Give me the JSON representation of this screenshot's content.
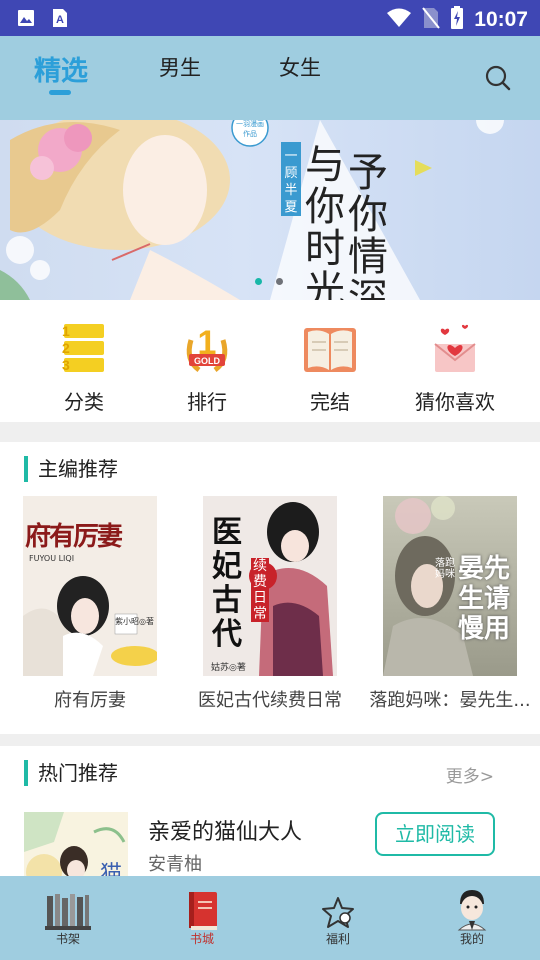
{
  "status_bar": {
    "time": "10:07",
    "icons": [
      "image-icon",
      "text-icon",
      "wifi-icon",
      "no-sim-icon",
      "battery-icon"
    ]
  },
  "header": {
    "tabs": [
      {
        "label": "精选",
        "active": true
      },
      {
        "label": "男生",
        "active": false
      },
      {
        "label": "女生",
        "active": false
      }
    ],
    "search_icon": "search-icon"
  },
  "banner": {
    "author_tag": "一顾半夏",
    "studio_tag": "一羽漫画 作品",
    "title_lines": [
      "与你",
      "时光",
      "予你",
      "情深"
    ],
    "slides": 2,
    "active_slide": 0
  },
  "menu": {
    "items": [
      {
        "label": "分类",
        "icon": "category-icon"
      },
      {
        "label": "排行",
        "icon": "ranking-icon"
      },
      {
        "label": "完结",
        "icon": "finished-book-icon"
      },
      {
        "label": "猜你喜欢",
        "icon": "heart-envelope-icon"
      }
    ]
  },
  "editor_picks": {
    "title": "主编推荐",
    "books": [
      {
        "title": "府有厉妻",
        "cover_text": "府有厉妻",
        "cover_sub": "FUYOU LIQI",
        "author_mark": "紫小昭◎著"
      },
      {
        "title": "医妃古代续费日常",
        "cover_text": "医妃古代",
        "cover_sub": "续费日常",
        "author_mark": "姑苏◎著"
      },
      {
        "title": "落跑妈咪：晏先生...",
        "cover_text": "晏先生请慢用",
        "cover_sub": "落跑妈咪"
      }
    ]
  },
  "hot_picks": {
    "title": "热门推荐",
    "more_label": "更多>",
    "book": {
      "title": "亲爱的猫仙大人",
      "author": "安青柚",
      "cover_text": "猫",
      "button": "立即阅读"
    }
  },
  "bottom_nav": {
    "items": [
      {
        "label": "书架",
        "icon": "bookshelf-icon"
      },
      {
        "label": "书城",
        "icon": "bookstore-icon",
        "active": true
      },
      {
        "label": "福利",
        "icon": "welfare-star-icon"
      },
      {
        "label": "我的",
        "icon": "profile-avatar-icon"
      }
    ]
  },
  "colors": {
    "status_bar": "#3f47b4",
    "header": "#9fcde0",
    "accent": "#2c9fd9",
    "teal": "#1fbaa6"
  }
}
